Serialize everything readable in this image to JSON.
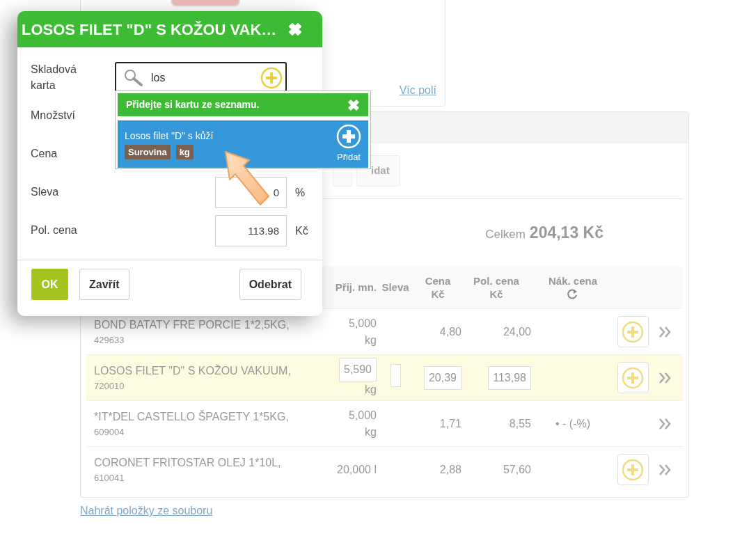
{
  "top_card": {
    "link": "Víc polí"
  },
  "list_card": {
    "add_button": "idat",
    "total_label": "Celkem",
    "total_value": "204,13 Kč"
  },
  "table": {
    "columns": [
      {
        "label": "Přij. mn."
      },
      {
        "label": "Sleva"
      },
      {
        "label": "Cena",
        "unit": "Kč"
      },
      {
        "label": "Pol. cena",
        "unit": "Kč"
      },
      {
        "label": "Nák. cena",
        "refresh": true
      }
    ],
    "rows": [
      {
        "name": "BOND BATATY FRE PORCIE 1*2,5KG,",
        "code": "429633",
        "qty": "5,000",
        "unit": "kg",
        "price": "4,80",
        "total": "24,00",
        "add": true,
        "selected": false
      },
      {
        "name": "LOSOS FILET \"D\" S KOŽOU VAKUUM,",
        "code": "720010",
        "qty": "5,590",
        "unit": "kg",
        "price": "20,39",
        "total": "113,98",
        "add": true,
        "selected": true
      },
      {
        "name": "*IT*DEL CASTELLO ŠPAGETY 1*5KG,",
        "code": "609004",
        "qty": "5,000",
        "unit": "kg",
        "price": "1,71",
        "total": "8,55",
        "purchase": "• - (-%)",
        "add": false,
        "selected": false
      },
      {
        "name": "CORONET FRITOSTAR OLEJ 1*10L,",
        "code": "610041",
        "qty": "20,000",
        "unit": "l",
        "price": "2,88",
        "total": "57,60",
        "add": true,
        "selected": false
      }
    ]
  },
  "upload_link": "Nahrát položky ze souboru",
  "modal": {
    "title": "LOSOS FILET \"D\" S KOŽOU VAK…",
    "fields": [
      {
        "label": "Skladová karta",
        "kind": "search",
        "value": "los"
      },
      {
        "label": "Množství",
        "kind": "covered"
      },
      {
        "label": "Cena",
        "kind": "covered"
      },
      {
        "label": "Sleva",
        "kind": "number",
        "value": "0",
        "unit": "%"
      },
      {
        "label": "Pol. cena",
        "kind": "number",
        "value": "113.98",
        "unit": "Kč"
      }
    ],
    "buttons": [
      {
        "label": "OK",
        "kind": "primary"
      },
      {
        "label": "Zavřít",
        "kind": "default"
      },
      {
        "label": "Odebrat",
        "kind": "default"
      }
    ]
  },
  "dropdown": {
    "hint": "Přidejte si kartu ze seznamu.",
    "items": [
      {
        "name": "Losos filet \"D\" s kůží",
        "tags": [
          "Surovina",
          "kg"
        ],
        "action": "Přidat",
        "selected": true
      }
    ]
  }
}
